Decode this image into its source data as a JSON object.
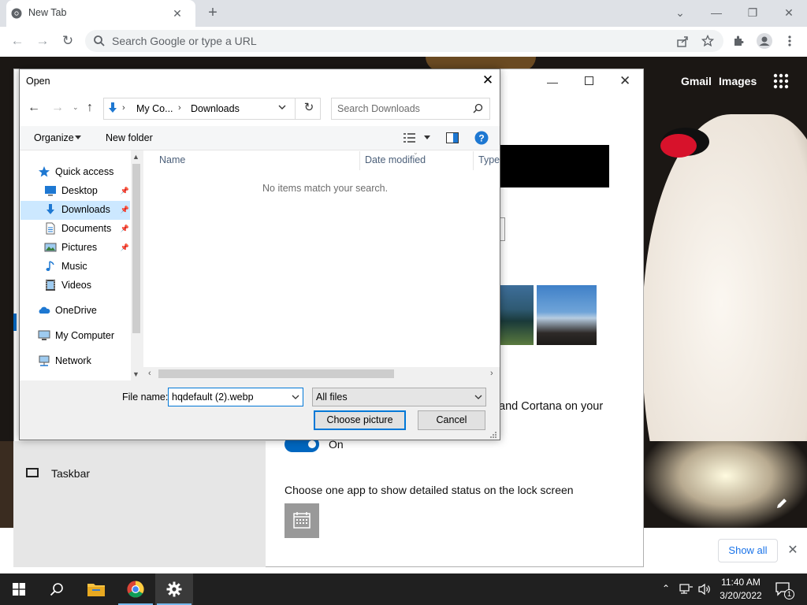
{
  "browser": {
    "tab_title": "New Tab",
    "tab_close": "✕",
    "new_tab": "+",
    "omnibox_placeholder": "Search Google or type a URL",
    "win_min": "⌄",
    "win_minimize": "—",
    "win_restore": "❐",
    "win_close": "✕"
  },
  "ntp": {
    "gmail": "Gmail",
    "images": "Images",
    "show_all": "Show all",
    "close": "✕"
  },
  "settings": {
    "taskbar_label": "Taskbar",
    "cortana_text": "and Cortana on your",
    "toggle_state": "On",
    "lockscreen_text": "Choose one app to show detailed status on the lock screen",
    "min": "—",
    "close": "✕"
  },
  "dialog": {
    "title": "Open",
    "close": "✕",
    "breadcrumb": [
      "My Co...",
      "Downloads"
    ],
    "breadcrumb_sep": "›",
    "search_placeholder": "Search Downloads",
    "organize": "Organize",
    "new_folder": "New folder",
    "nav_items": [
      {
        "label": "Quick access",
        "icon": "star-icon"
      },
      {
        "label": "Desktop",
        "icon": "desktop-icon",
        "pinned": true
      },
      {
        "label": "Downloads",
        "icon": "download-icon",
        "pinned": true,
        "selected": true
      },
      {
        "label": "Documents",
        "icon": "documents-icon",
        "pinned": true
      },
      {
        "label": "Pictures",
        "icon": "pictures-icon",
        "pinned": true
      },
      {
        "label": "Music",
        "icon": "music-icon"
      },
      {
        "label": "Videos",
        "icon": "videos-icon"
      },
      {
        "label": "OneDrive",
        "icon": "cloud-icon"
      },
      {
        "label": "My Computer",
        "icon": "computer-icon"
      },
      {
        "label": "Network",
        "icon": "network-icon"
      }
    ],
    "columns": [
      "Name",
      "Date modified",
      "Type"
    ],
    "empty_message": "No items match your search.",
    "file_name_label": "File name:",
    "file_name_value": "hqdefault (2).webp",
    "file_type": "All files",
    "choose_button": "Choose picture",
    "cancel_button": "Cancel"
  },
  "taskbar": {
    "time": "11:40 AM",
    "date": "3/20/2022",
    "notification_count": "1"
  },
  "colors": {
    "accent": "#0067c0",
    "selected": "#cce8ff"
  }
}
